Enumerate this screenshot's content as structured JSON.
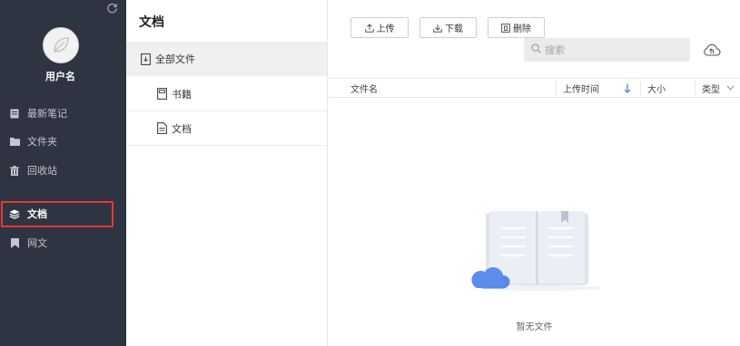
{
  "sidebar": {
    "username": "用户名",
    "items": [
      {
        "label": "最新笔记",
        "icon": "note-icon"
      },
      {
        "label": "文件夹",
        "icon": "folder-icon"
      },
      {
        "label": "回收站",
        "icon": "trash-icon"
      },
      {
        "label": "文档",
        "icon": "layers-icon",
        "active": true
      },
      {
        "label": "网文",
        "icon": "bookmark-icon"
      }
    ]
  },
  "middle": {
    "title": "文档",
    "items": [
      {
        "label": "全部文件",
        "selected": true
      },
      {
        "label": "书籍"
      },
      {
        "label": "文档"
      }
    ]
  },
  "toolbar": {
    "upload_label": "上传",
    "download_label": "下载",
    "delete_label": "删除"
  },
  "search": {
    "placeholder": "搜索"
  },
  "table": {
    "columns": [
      "文件名",
      "上传时间",
      "大小",
      "类型"
    ]
  },
  "empty": {
    "text": "暂无文件"
  },
  "colors": {
    "sidebar_bg": "#2f3442",
    "active_outline": "#e53935",
    "sort_arrow": "#3a7bd5",
    "cloud": "#5b8def"
  }
}
